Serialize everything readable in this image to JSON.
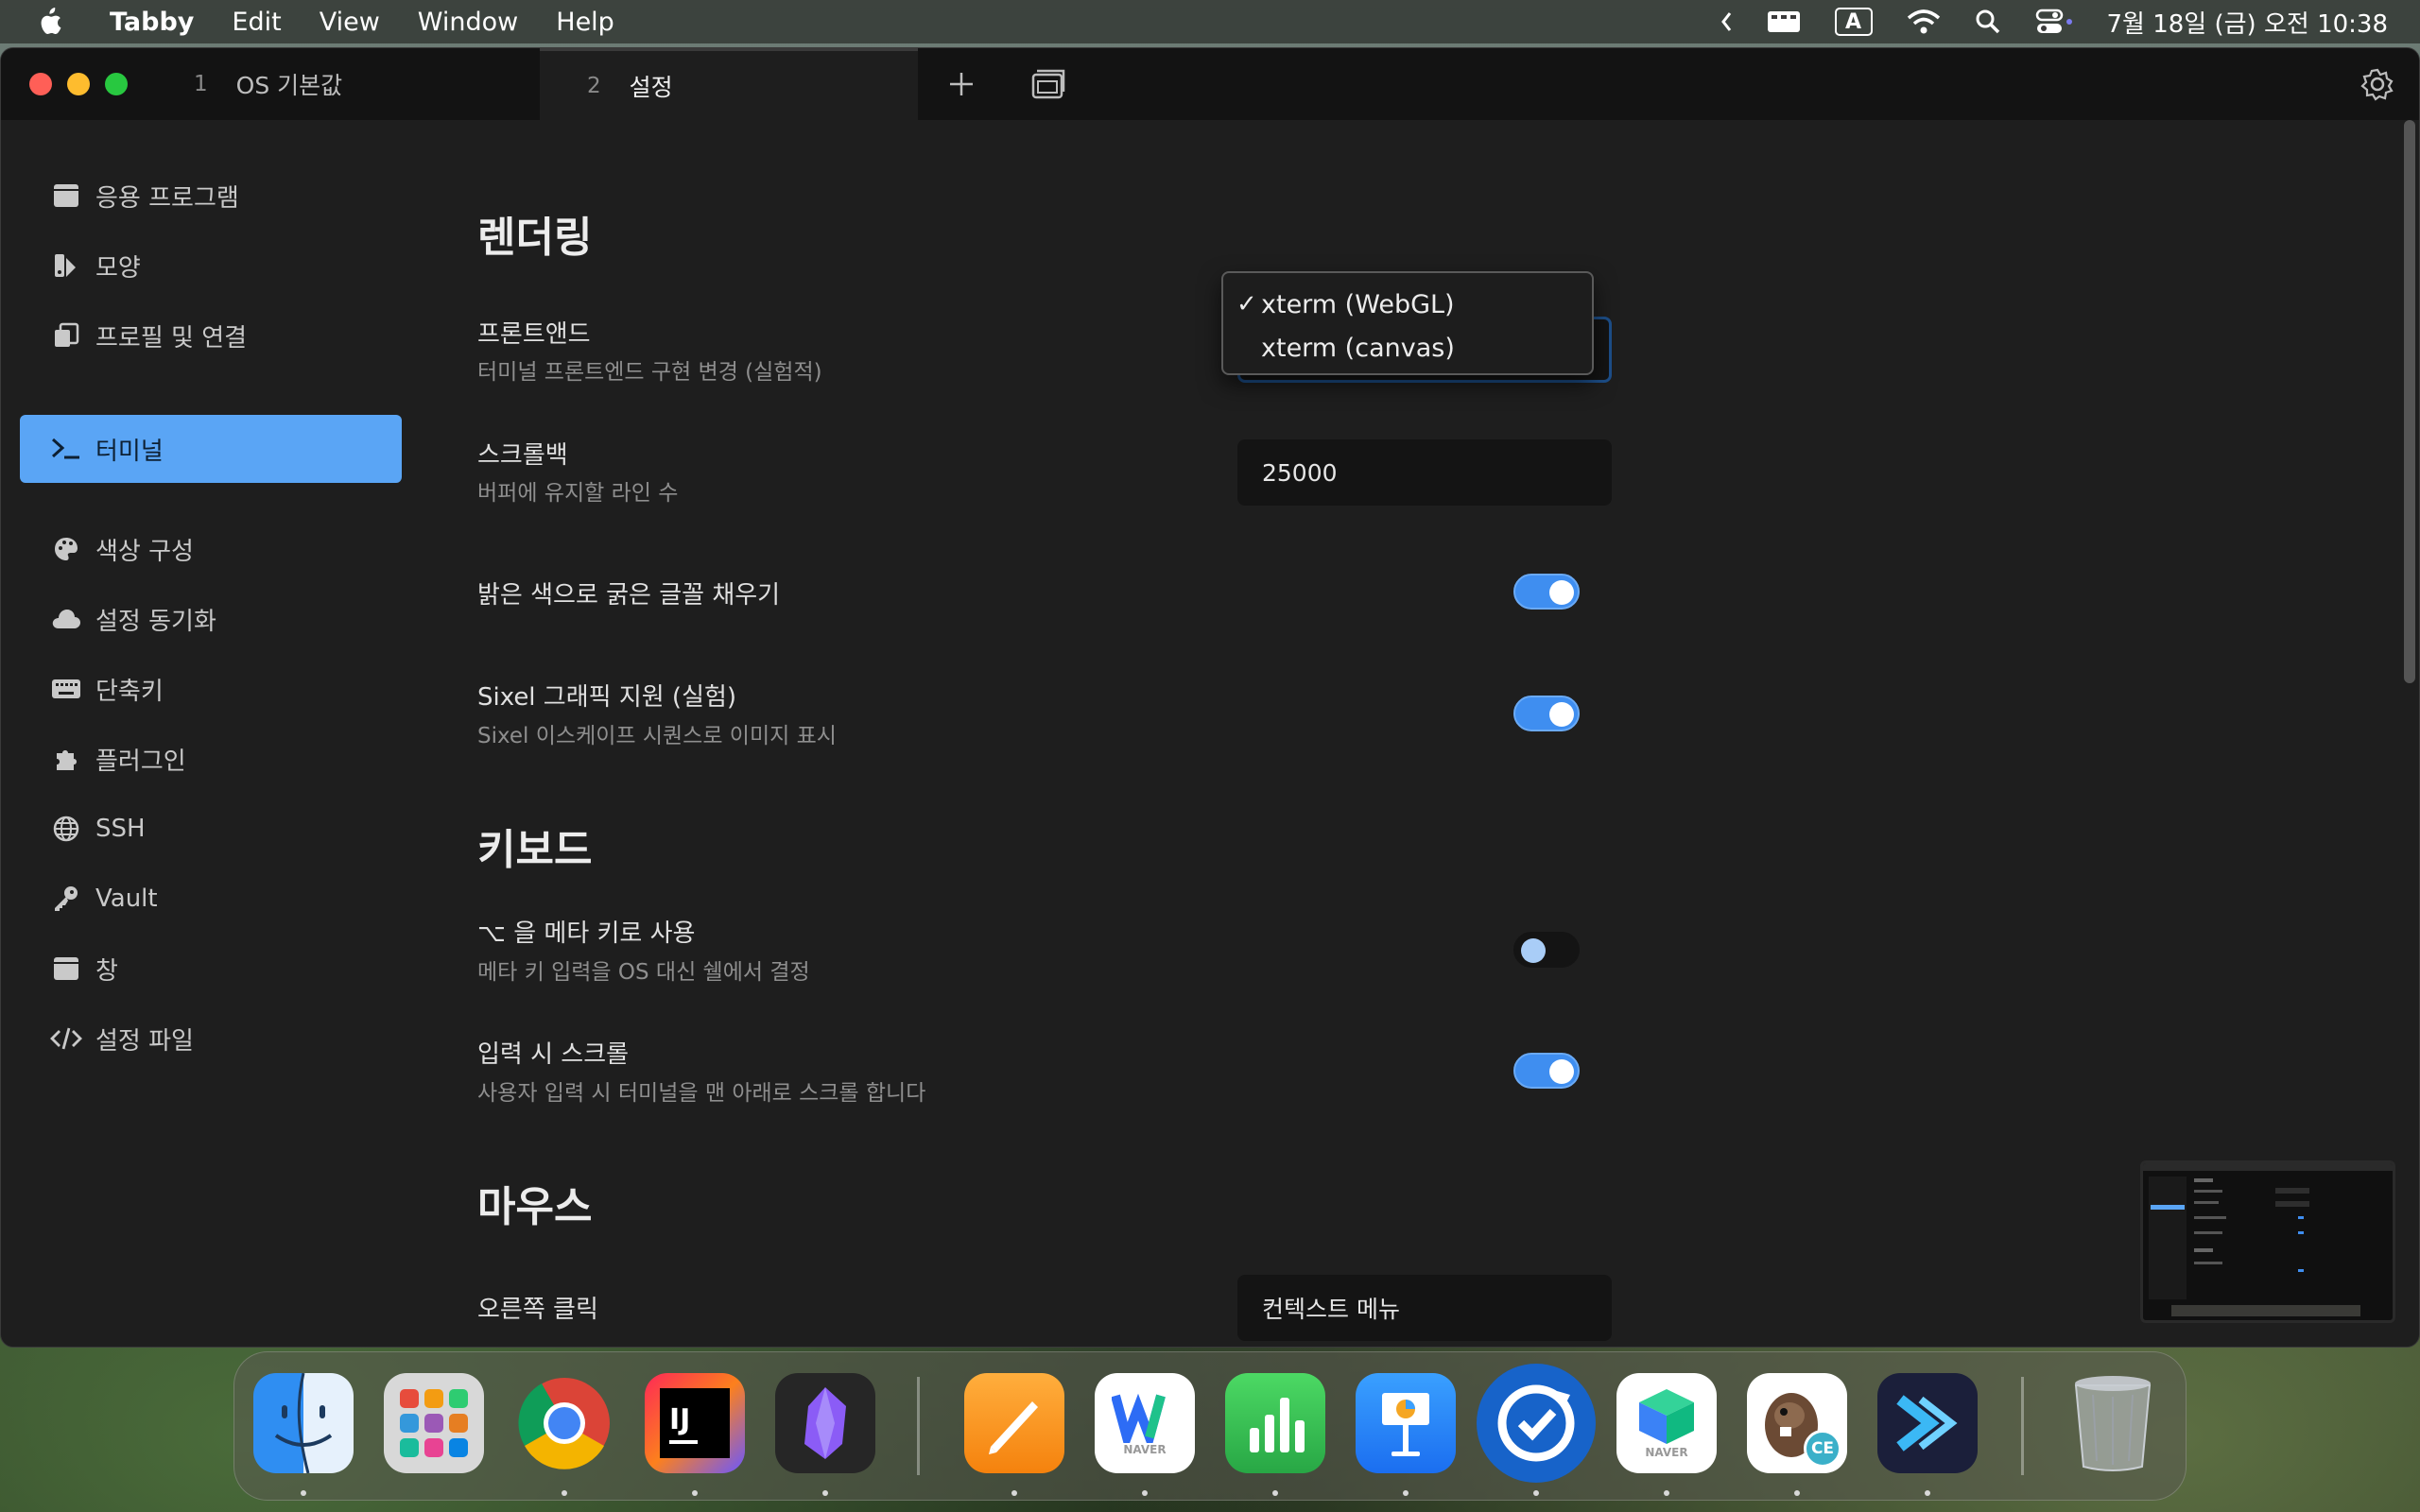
{
  "menubar": {
    "app_name": "Tabby",
    "items": [
      "Edit",
      "View",
      "Window",
      "Help"
    ],
    "clock": "7월 18일 (금) 오전 10:38",
    "input_indicator": "A"
  },
  "tabs": [
    {
      "num": "1",
      "label": "OS 기본값"
    },
    {
      "num": "2",
      "label": "설정"
    }
  ],
  "sidebar": {
    "items": [
      {
        "label": "응용 프로그램",
        "icon": "window-icon"
      },
      {
        "label": "모양",
        "icon": "paint-icon"
      },
      {
        "label": "프로필 및 연결",
        "icon": "profiles-icon"
      },
      {
        "label": "터미널",
        "icon": "terminal-icon"
      },
      {
        "label": "색상 구성",
        "icon": "palette-icon"
      },
      {
        "label": "설정 동기화",
        "icon": "cloud-icon"
      },
      {
        "label": "단축키",
        "icon": "keyboard-icon"
      },
      {
        "label": "플러그인",
        "icon": "puzzle-icon"
      },
      {
        "label": "SSH",
        "icon": "globe-icon"
      },
      {
        "label": "Vault",
        "icon": "key-icon"
      },
      {
        "label": "창",
        "icon": "window-icon"
      },
      {
        "label": "설정 파일",
        "icon": "code-icon"
      }
    ],
    "active_index": 3
  },
  "content": {
    "rendering": {
      "title": "렌더링",
      "frontend_title": "프론트앤드",
      "frontend_desc": "터미널 프론트엔드 구현 변경 (실험적)",
      "scrollback_title": "스크롤백",
      "scrollback_desc": "버퍼에 유지할 라인 수",
      "scrollback_value": "25000",
      "bold_bright_title": "밝은 색으로 굵은 글꼴 채우기",
      "bold_bright_on": true,
      "sixel_title": "Sixel 그래픽 지원 (실험)",
      "sixel_desc": "Sixel 이스케이프 시퀀스로 이미지 표시",
      "sixel_on": true
    },
    "keyboard": {
      "title": "키보드",
      "meta_title": "⌥ 을 메타 키로 사용",
      "meta_desc": "메타 키 입력을 OS 대신 쉘에서 결정",
      "meta_on": false,
      "scroll_input_title": "입력 시 스크롤",
      "scroll_input_desc": "사용자 입력 시 터미널을 맨 아래로 스크롤 합니다",
      "scroll_input_on": true
    },
    "mouse": {
      "title": "마우스",
      "right_click_title": "오른쪽 클릭",
      "right_click_value": "컨텍스트 메뉴"
    }
  },
  "dropdown": {
    "options": [
      "xterm (WebGL)",
      "xterm (canvas)"
    ],
    "selected_index": 0,
    "check": "✓"
  },
  "colors": {
    "accent": "#5aa5f5",
    "toggle_on": "#3f8ef0",
    "background": "#1e1e1e",
    "tabbar": "#131313"
  },
  "dock": {
    "apps": [
      {
        "name": "finder",
        "running": true
      },
      {
        "name": "launchpad",
        "running": false
      },
      {
        "name": "chrome",
        "running": true
      },
      {
        "name": "intellij",
        "running": true
      },
      {
        "name": "obsidian",
        "running": true
      },
      {
        "name": "pages",
        "running": true
      },
      {
        "name": "naver-works",
        "running": true
      },
      {
        "name": "numbers",
        "running": true
      },
      {
        "name": "keynote",
        "running": true
      },
      {
        "name": "sync-app",
        "running": true
      },
      {
        "name": "naver-box",
        "running": true
      },
      {
        "name": "dbeaver-ce",
        "running": true
      },
      {
        "name": "tabby",
        "running": true
      },
      {
        "name": "trash",
        "running": false
      }
    ],
    "label_naver": "NAVER",
    "label_ce": "CE",
    "label_ij": "IJ"
  }
}
